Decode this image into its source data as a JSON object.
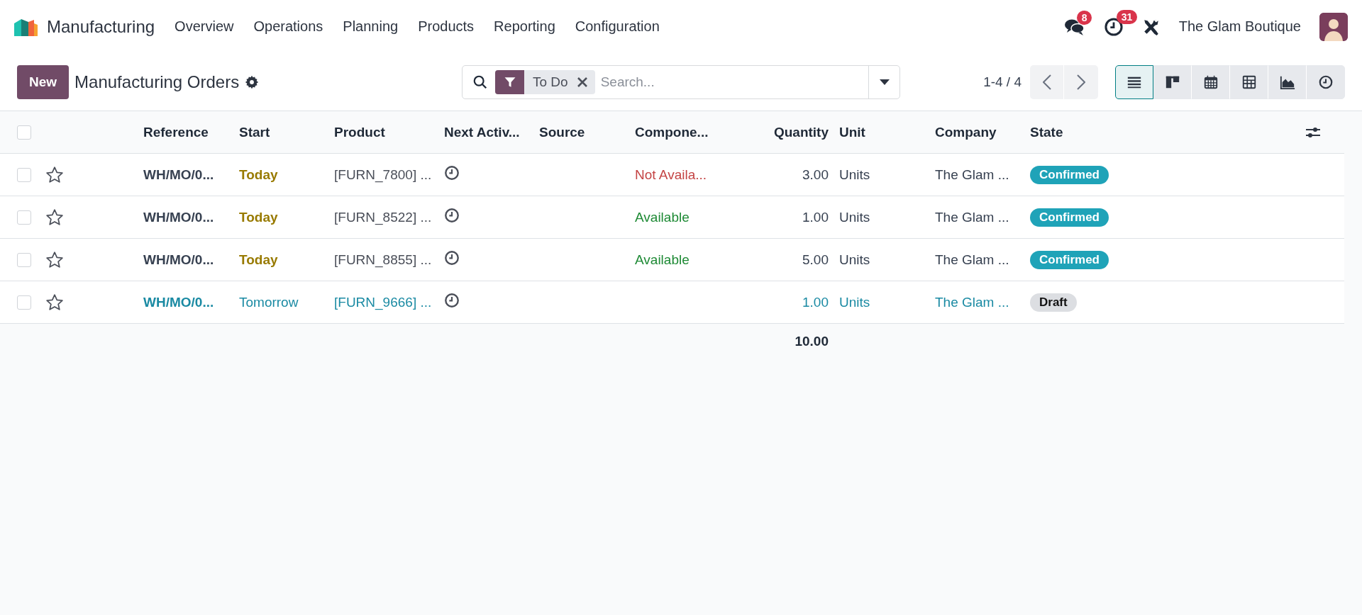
{
  "navbar": {
    "app_name": "Manufacturing",
    "menu": [
      "Overview",
      "Operations",
      "Planning",
      "Products",
      "Reporting",
      "Configuration"
    ],
    "messages_badge": "8",
    "activities_badge": "31",
    "company": "The Glam Boutique"
  },
  "control_panel": {
    "new_button": "New",
    "title": "Manufacturing Orders",
    "search": {
      "facet": "To Do",
      "placeholder": "Search..."
    },
    "pager": "1-4 / 4",
    "views": [
      {
        "kind": "list",
        "selected": true
      },
      {
        "kind": "kanban",
        "selected": false
      },
      {
        "kind": "calendar",
        "selected": false
      },
      {
        "kind": "pivot",
        "selected": false
      },
      {
        "kind": "graph",
        "selected": false
      },
      {
        "kind": "activity",
        "selected": false
      }
    ]
  },
  "table": {
    "all_selected": false,
    "columns": [
      "Reference",
      "Start",
      "Product",
      "Next Activ...",
      "Source",
      "Compone...",
      "Quantity",
      "Unit",
      "Company",
      "State"
    ],
    "rows": [
      {
        "kind": "confirmed",
        "selected": false,
        "starred": false,
        "reference": "WH/MO/0...",
        "start": "Today",
        "start_highlighted": true,
        "product": "[FURN_7800] ...",
        "components": "Not Availa...",
        "components_available": false,
        "quantity": "3.00",
        "unit": "Units",
        "company": "The Glam ...",
        "state": "Confirmed"
      },
      {
        "kind": "confirmed",
        "selected": false,
        "starred": false,
        "reference": "WH/MO/0...",
        "start": "Today",
        "start_highlighted": true,
        "product": "[FURN_8522] ...",
        "components": "Available",
        "components_available": true,
        "quantity": "1.00",
        "unit": "Units",
        "company": "The Glam ...",
        "state": "Confirmed"
      },
      {
        "kind": "confirmed",
        "selected": false,
        "starred": false,
        "reference": "WH/MO/0...",
        "start": "Today",
        "start_highlighted": true,
        "product": "[FURN_8855] ...",
        "components": "Available",
        "components_available": true,
        "quantity": "5.00",
        "unit": "Units",
        "company": "The Glam ...",
        "state": "Confirmed"
      },
      {
        "kind": "draft",
        "selected": false,
        "starred": false,
        "reference": "WH/MO/0...",
        "start": "Tomorrow",
        "start_highlighted": false,
        "product": "[FURN_9666] ...",
        "quantity": "1.00",
        "unit": "Units",
        "company": "The Glam ...",
        "state": "Draft"
      }
    ],
    "total_quantity": "10.00"
  }
}
